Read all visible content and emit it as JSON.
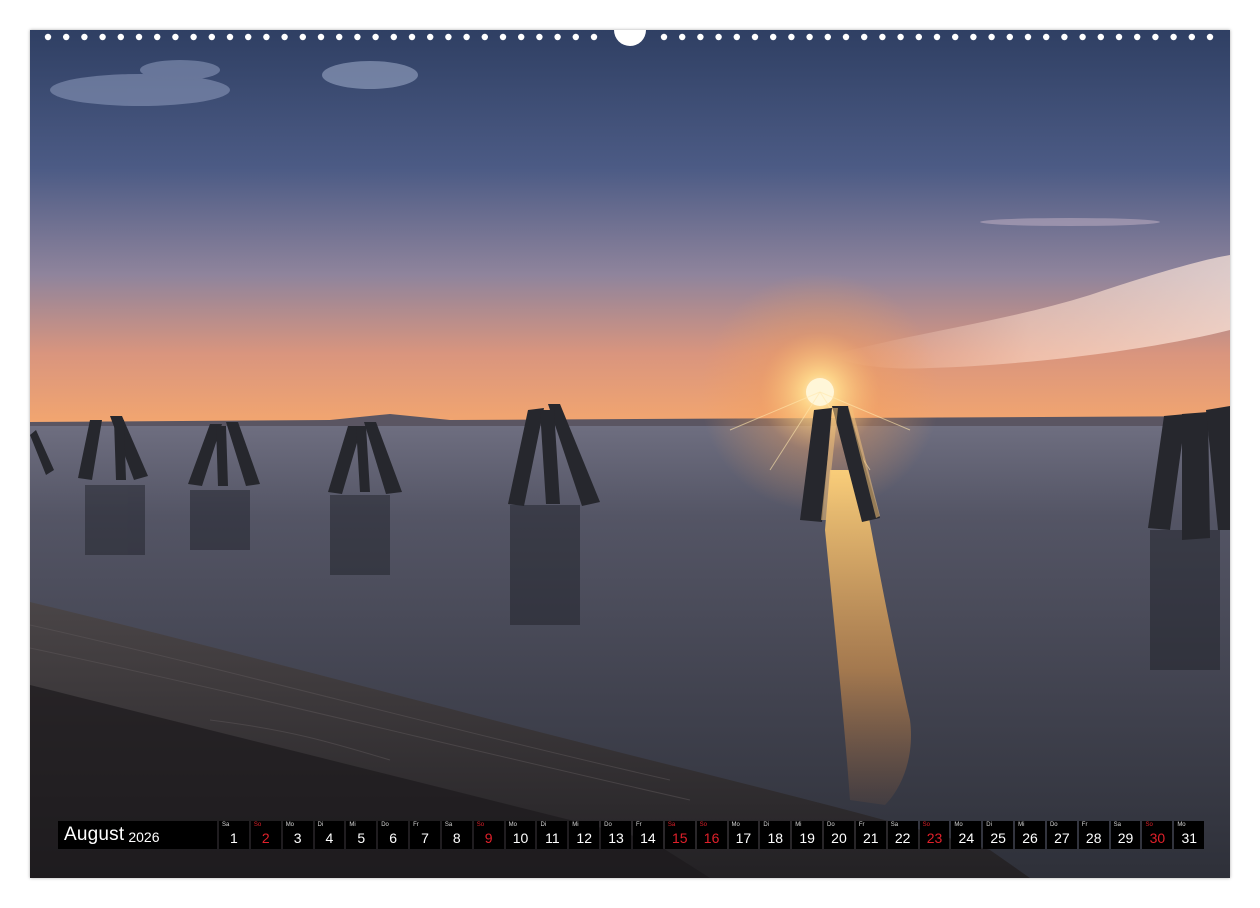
{
  "calendar": {
    "month": "August",
    "year": "2026",
    "holiday_color": "#e0202a",
    "days": [
      {
        "dow": "Sa",
        "num": "1",
        "red": false
      },
      {
        "dow": "So",
        "num": "2",
        "red": true
      },
      {
        "dow": "Mo",
        "num": "3",
        "red": false
      },
      {
        "dow": "Di",
        "num": "4",
        "red": false
      },
      {
        "dow": "Mi",
        "num": "5",
        "red": false
      },
      {
        "dow": "Do",
        "num": "6",
        "red": false
      },
      {
        "dow": "Fr",
        "num": "7",
        "red": false
      },
      {
        "dow": "Sa",
        "num": "8",
        "red": false
      },
      {
        "dow": "So",
        "num": "9",
        "red": true
      },
      {
        "dow": "Mo",
        "num": "10",
        "red": false
      },
      {
        "dow": "Di",
        "num": "11",
        "red": false
      },
      {
        "dow": "Mi",
        "num": "12",
        "red": false
      },
      {
        "dow": "Do",
        "num": "13",
        "red": false
      },
      {
        "dow": "Fr",
        "num": "14",
        "red": false
      },
      {
        "dow": "Sa",
        "num": "15",
        "red": true
      },
      {
        "dow": "So",
        "num": "16",
        "red": true
      },
      {
        "dow": "Mo",
        "num": "17",
        "red": false
      },
      {
        "dow": "Di",
        "num": "18",
        "red": false
      },
      {
        "dow": "Mi",
        "num": "19",
        "red": false
      },
      {
        "dow": "Do",
        "num": "20",
        "red": false
      },
      {
        "dow": "Fr",
        "num": "21",
        "red": false
      },
      {
        "dow": "Sa",
        "num": "22",
        "red": false
      },
      {
        "dow": "So",
        "num": "23",
        "red": true
      },
      {
        "dow": "Mo",
        "num": "24",
        "red": false
      },
      {
        "dow": "Di",
        "num": "25",
        "red": false
      },
      {
        "dow": "Mi",
        "num": "26",
        "red": false
      },
      {
        "dow": "Do",
        "num": "27",
        "red": false
      },
      {
        "dow": "Fr",
        "num": "28",
        "red": false
      },
      {
        "dow": "Sa",
        "num": "29",
        "red": false
      },
      {
        "dow": "So",
        "num": "30",
        "red": true
      },
      {
        "dow": "Mo",
        "num": "31",
        "red": false
      }
    ]
  },
  "photo": {
    "subject": "sunset-over-lake-with-wooden-posts",
    "sky_top": "#3a4a6e",
    "sky_horizon": "#f2a070",
    "sun_color": "#fff2c0",
    "water_color": "#3c3f4c"
  }
}
